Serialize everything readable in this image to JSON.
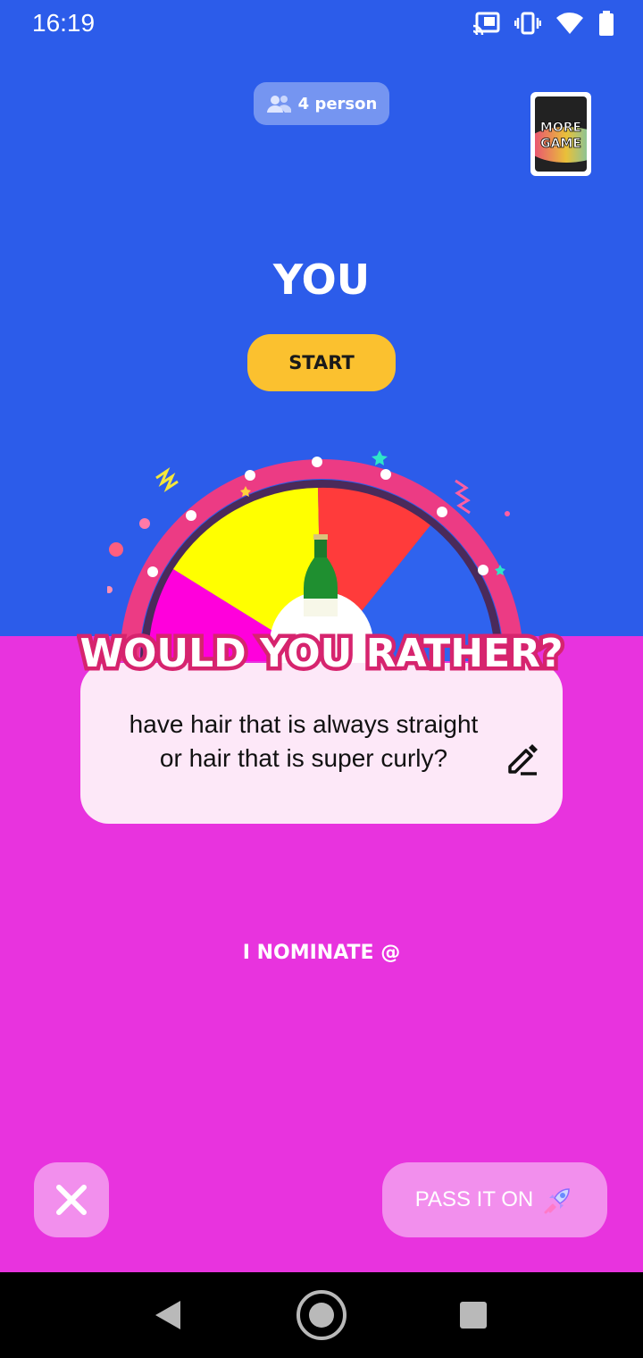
{
  "status_bar": {
    "time": "16:19",
    "icons": [
      "cast-icon",
      "vibrate-icon",
      "wifi-icon",
      "battery-icon"
    ]
  },
  "header": {
    "players_label": "4 person",
    "players_icon": "people-icon",
    "more_game_label_line1": "MORE",
    "more_game_label_line2": "GAME"
  },
  "turn": {
    "player_name": "YOU",
    "start_label": "START"
  },
  "wheel": {
    "segments": [
      "#ff00dc",
      "#ffff00",
      "#ff3b3b",
      "#2f63ee"
    ],
    "pointer_icon": "bottle-icon"
  },
  "card": {
    "banner_text": "WOULD YOU RATHER?",
    "question": "have hair that is always straight or hair that is super curly?",
    "edit_icon": "pencil-icon"
  },
  "nominate_label": "I NOMINATE @",
  "footer": {
    "close_icon": "close-icon",
    "pass_label": "PASS IT ON",
    "pass_icon": "rocket-icon"
  },
  "nav": {
    "icons": [
      "back-icon",
      "home-icon",
      "recents-icon"
    ]
  },
  "colors": {
    "top_background": "#2c5cea",
    "bottom_background": "#e833de",
    "start_button": "#fbc12f",
    "wheel_rim": "#ec3b84"
  }
}
